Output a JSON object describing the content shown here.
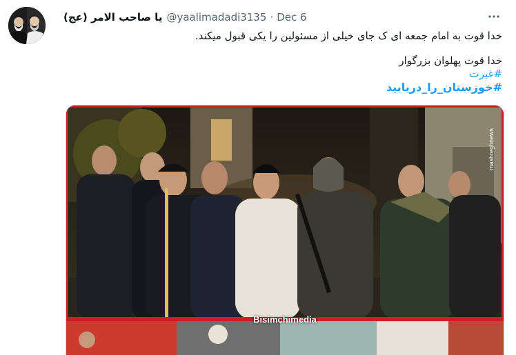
{
  "tweet": {
    "display_name": "یا صاحب الامر (عج)",
    "handle": "@yaalimadadi3135",
    "separator": "·",
    "date": "Dec 6",
    "more_icon": "more-options-icon",
    "lines": [
      "خدا قوت به امام جمعه ای ک جای خیلی از مسئولین را یکی قبول میکند.",
      "خدا قوت پهلوان بزرگوار"
    ],
    "hashtags": [
      "#غیرت",
      "#خوزستان_را_دریابید"
    ]
  },
  "media": {
    "watermark": "Bisimchimedia",
    "side_watermark": "mashreghnews"
  },
  "colors": {
    "link": "#1d9bf0",
    "secondary_text": "#536471",
    "media_frame": "#d11a2a"
  }
}
